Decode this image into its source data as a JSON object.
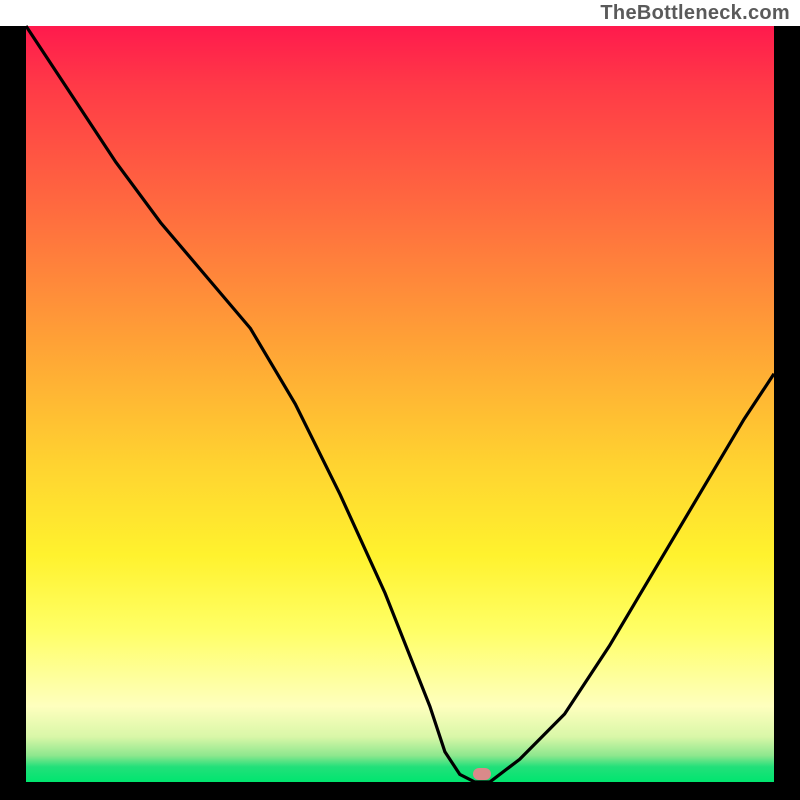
{
  "attribution": "TheBottleneck.com",
  "colors": {
    "curve": "#000000",
    "marker": "#d98a8a"
  },
  "chart_data": {
    "type": "line",
    "title": "",
    "xlabel": "",
    "ylabel": "",
    "xlim": [
      0,
      100
    ],
    "ylim": [
      0,
      100
    ],
    "grid": false,
    "legend": false,
    "background": "gradient-red-to-green-vertical",
    "series": [
      {
        "name": "bottleneck-curve",
        "x": [
          0,
          6,
          12,
          18,
          24,
          30,
          36,
          42,
          48,
          54,
          56,
          58,
          60,
          62,
          66,
          72,
          78,
          84,
          90,
          96,
          100
        ],
        "y": [
          100,
          91,
          82,
          74,
          67,
          60,
          50,
          38,
          25,
          10,
          4,
          1,
          0,
          0,
          3,
          9,
          18,
          28,
          38,
          48,
          54
        ]
      }
    ],
    "annotations": [
      {
        "name": "optimal-marker",
        "x": 61,
        "y": 1,
        "shape": "rounded-rect",
        "color": "#d98a8a"
      }
    ]
  }
}
